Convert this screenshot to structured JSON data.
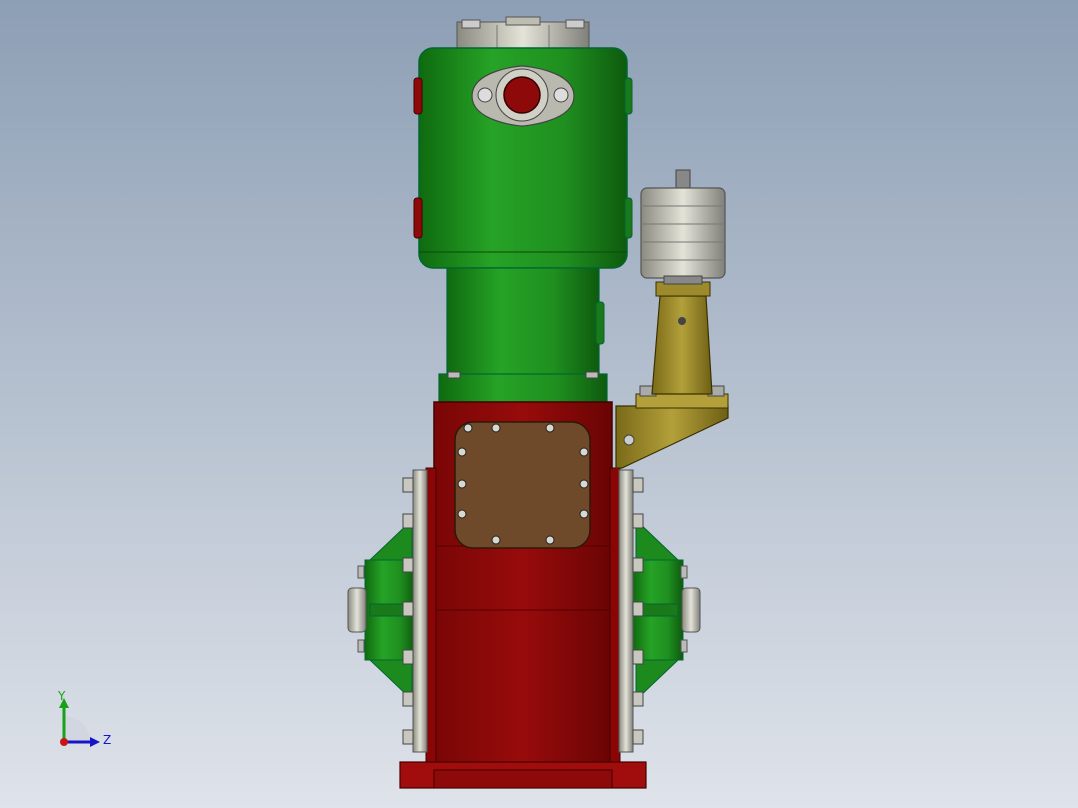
{
  "viewport": {
    "background_top": "#8d9fb5",
    "background_bottom": "#dfe3ea"
  },
  "colors": {
    "cylinder_green": "#1f8f1f",
    "cylinder_green_dark": "#0f5f0f",
    "frame_red": "#8e0a0a",
    "frame_red_dark": "#5c0000",
    "cover_brown": "#6e4a2a",
    "bracket_olive": "#9c8a2c",
    "metal_grey": "#a9a9a9",
    "metal_light": "#d8d8cc"
  },
  "triad": {
    "y_label": "Y",
    "z_label": "Z",
    "y_color": "#19a019",
    "z_color": "#1616c8",
    "x_color": "#c81616"
  }
}
